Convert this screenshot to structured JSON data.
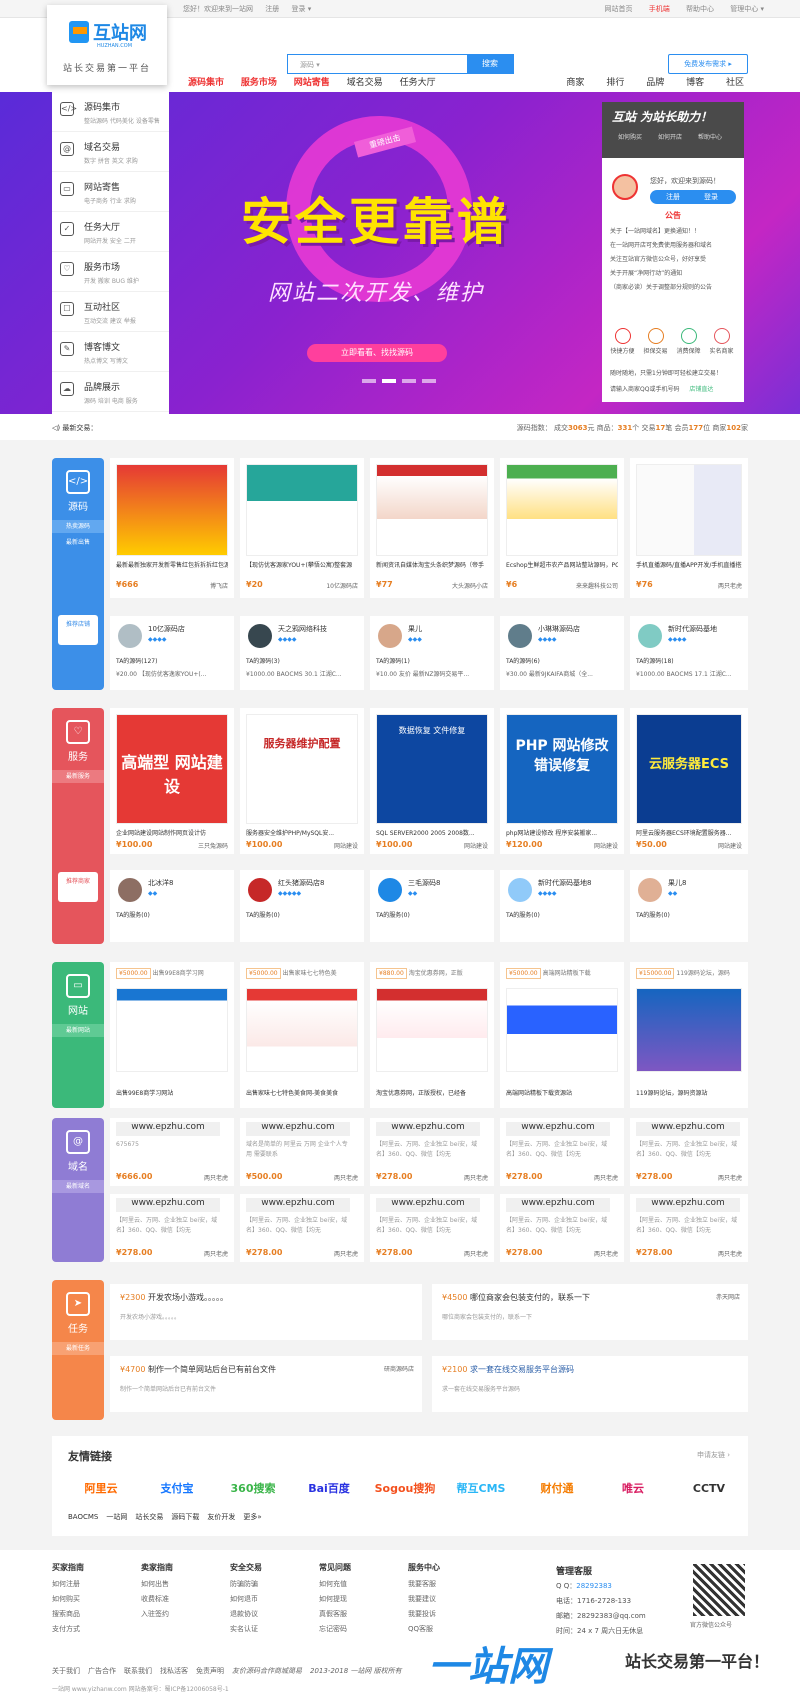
{
  "topbar": {
    "greeting": "您好！欢迎来到一站网",
    "login": "注册",
    "logout": "登录 ▾",
    "right": [
      "网站首页",
      "手机端",
      "帮助中心",
      "管理中心 ▾"
    ]
  },
  "logo": {
    "name": "互站网",
    "url": "HUZHAN.COM",
    "slogan": "站长交易第一平台"
  },
  "search": {
    "placeholder": "源码 ▾",
    "button": "搜索",
    "publish": "免费发布需求 ▸"
  },
  "nav": {
    "left": [
      "源码集市",
      "服务市场",
      "网站寄售",
      "域名交易",
      "任务大厅"
    ],
    "right": [
      "商家",
      "排行",
      "品牌",
      "博客",
      "社区"
    ]
  },
  "sidemenu": [
    {
      "icon": "</>",
      "title": "源码集市",
      "sub": "整站源码 代码美化 设备零售"
    },
    {
      "icon": "@",
      "title": "域名交易",
      "sub": "数字 拼音 英文 求购"
    },
    {
      "icon": "▭",
      "title": "网站寄售",
      "sub": "电子商务 行业 求购"
    },
    {
      "icon": "✓",
      "title": "任务大厅",
      "sub": "网站开发 安全 二开"
    },
    {
      "icon": "♡",
      "title": "服务市场",
      "sub": "开发 搬家 BUG 维护"
    },
    {
      "icon": "☐",
      "title": "互动社区",
      "sub": "互动交流 建议 举报"
    },
    {
      "icon": "✎",
      "title": "博客博文",
      "sub": "热点博文 写博文"
    },
    {
      "icon": "☁",
      "title": "品牌展示",
      "sub": "源码 培训 电商 服务"
    }
  ],
  "banner": {
    "ribbon": "重磅出击",
    "title": "安全更靠谱",
    "subtitle": "网站二次开发、维护",
    "button": "立即看看、找找源码"
  },
  "rpanel": {
    "brand": "互站 为站长助力！",
    "icons": [
      "如何购买",
      "如何开店",
      "帮助中心"
    ],
    "hello": "您好，欢迎来到源码！",
    "register": "注册",
    "login": "登录",
    "notice": "公告",
    "list": [
      "关于【一站网域名】更换通知！！",
      "在一站网开店可免费使用服务器和域名",
      "关注互站官方微信公众号，好好享受",
      "关于开展“净网行动”的通知",
      "（商家必读）关于调整部分规则的公告"
    ],
    "features": [
      "快捷方便",
      "担保交易",
      "消费保障",
      "实名商家"
    ],
    "promo": "随时随地，只需1分钟即可轻松建立交易！",
    "qq": "请输入商家QQ或手机号码",
    "qq_btn": "店铺直达"
  },
  "news": {
    "label": "最新交易：",
    "stats": [
      "源码指数：",
      "成交",
      "3063",
      "元",
      "商品：",
      "331",
      "个",
      "交易",
      "17",
      "笔",
      "会员",
      "177",
      "位",
      "商家",
      "102",
      "家"
    ]
  },
  "source": {
    "name": "源码",
    "tags": [
      "热卖源码",
      "最新出售"
    ],
    "rec": "推荐店铺",
    "items": [
      {
        "title": "最新最新独家开发新零售红包拆拆拆红包源",
        "price": "¥666",
        "shop": "博飞店"
      },
      {
        "title": "【现仿优客源家YOU+(攀悟公寓)整套源",
        "price": "¥20",
        "shop": "10亿源码店"
      },
      {
        "title": "新闻资讯自媒体淘宝头条织梦源码（帝手",
        "price": "¥77",
        "shop": "大头源码小店"
      },
      {
        "title": "Ecshop生鲜超市农产品网站整站源码，PC",
        "price": "¥6",
        "shop": "来来趣科技公司"
      },
      {
        "title": "手机直播源码/直播APP开发/手机直播搭建",
        "price": "¥76",
        "shop": "两只老虎"
      }
    ],
    "shops": [
      {
        "name": "10亿源码店",
        "count": "TA的源码(127)",
        "line": "¥20.00 【现仿优客逸家YOU+(..."
      },
      {
        "name": "天之鸦网络科技",
        "count": "TA的源码(3)",
        "line": "¥1000.00 BAOCMS 30.1 江湖C..."
      },
      {
        "name": "果儿",
        "count": "TA的源码(1)",
        "line": "¥10.00 友价 最新NZ源码交易平..."
      },
      {
        "name": "小琳琳源码店",
        "count": "TA的源码(6)",
        "line": "¥30.00 最新9JKAIFA商城（全..."
      },
      {
        "name": "新时代源码基地",
        "count": "TA的源码(18)",
        "line": "¥1000.00 BAOCMS 17.1 江湖C..."
      }
    ]
  },
  "service": {
    "name": "服务",
    "tags": [
      "最新服务"
    ],
    "rec": "推荐商家",
    "items": [
      {
        "img": "高端型 网站建设",
        "title": "企业网站建设网站制作网页设计仿",
        "price": "¥100.00",
        "shop": "三只兔源码"
      },
      {
        "img": "服务器维护配置",
        "title": "服务器安全维护PHP/MySQL安...",
        "price": "¥100.00",
        "shop": "网站建设"
      },
      {
        "img": "数据恢复 文件修复",
        "title": "SQL SERVER2000 2005 2008数...",
        "price": "¥100.00",
        "shop": "网站建设"
      },
      {
        "img": "PHP 网站修改 错误修复",
        "title": "php网站建设修改 程序安装搬家...",
        "price": "¥120.00",
        "shop": "网站建设"
      },
      {
        "img": "云服务器ECS",
        "title": "阿里云服务器ECS环境配置服务器...",
        "price": "¥50.00",
        "shop": "网站建设"
      }
    ],
    "shops": [
      {
        "name": "北冰洋8",
        "count": "TA的服务(0)"
      },
      {
        "name": "红头猪源码店8",
        "count": "TA的服务(0)"
      },
      {
        "name": "三毛源码8",
        "count": "TA的服务(0)"
      },
      {
        "name": "新时代源码基地8",
        "count": "TA的服务(0)"
      },
      {
        "name": "果儿8",
        "count": "TA的服务(0)"
      }
    ]
  },
  "site": {
    "name": "网站",
    "tags": [
      "最新网站"
    ],
    "items": [
      {
        "price": "¥5000.00",
        "tag": "出售99E8商学习网",
        "title": "出售99E8商学习网站"
      },
      {
        "price": "¥5000.00",
        "tag": "出售家味七七特色美",
        "title": "出售家味七七特色美食网-美食美食"
      },
      {
        "price": "¥880.00",
        "tag": "淘宝优惠券网，正版",
        "title": "淘宝优惠券网，正版授权，已经备"
      },
      {
        "price": "¥5000.00",
        "tag": "高端网站精板下载",
        "title": "高端网站精板下载资源站"
      },
      {
        "price": "¥15000.00",
        "tag": "119源码论坛，源码",
        "title": "119源码论坛，源码资源站"
      }
    ]
  },
  "domain": {
    "name": "域名",
    "tags": [
      "最新域名"
    ],
    "items": [
      {
        "domain": "www.epzhu.com",
        "desc": "675675",
        "price": "¥666.00",
        "shop": "两只老虎"
      },
      {
        "domain": "www.epzhu.com",
        "desc": "域名是简单的 阿里云 万网 企业个人专用 需要联系",
        "price": "¥500.00",
        "shop": "两只老虎"
      },
      {
        "domain": "www.epzhu.com",
        "desc": "【阿里云、万网、企业独立 bei安，域名】360、QQ、微信【均无",
        "price": "¥278.00",
        "shop": "两只老虎"
      },
      {
        "domain": "www.epzhu.com",
        "desc": "【阿里云、万网、企业独立 bei安，域名】360、QQ、微信【均无",
        "price": "¥278.00",
        "shop": "两只老虎"
      },
      {
        "domain": "www.epzhu.com",
        "desc": "【阿里云、万网、企业独立 bei安，域名】360、QQ、微信【均无",
        "price": "¥278.00",
        "shop": "两只老虎"
      },
      {
        "domain": "www.epzhu.com",
        "desc": "【阿里云、万网、企业独立 bei安，域名】360、QQ、微信【均无",
        "price": "¥278.00",
        "shop": "两只老虎"
      },
      {
        "domain": "www.epzhu.com",
        "desc": "【阿里云、万网、企业独立 bei安，域名】360、QQ、微信【均无",
        "price": "¥278.00",
        "shop": "两只老虎"
      },
      {
        "domain": "www.epzhu.com",
        "desc": "【阿里云、万网、企业独立 bei安，域名】360、QQ、微信【均无",
        "price": "¥278.00",
        "shop": "两只老虎"
      },
      {
        "domain": "www.epzhu.com",
        "desc": "【阿里云、万网、企业独立 bei安，域名】360、QQ、微信【均无",
        "price": "¥278.00",
        "shop": "两只老虎"
      },
      {
        "domain": "www.epzhu.com",
        "desc": "【阿里云、万网、企业独立 bei安，域名】360、QQ、微信【均无",
        "price": "¥278.00",
        "shop": "两只老虎"
      }
    ]
  },
  "task": {
    "name": "任务",
    "tags": [
      "最新任务"
    ],
    "items": [
      {
        "price": "¥2300",
        "title": "开发农场小游戏。。。。。",
        "desc": "开发农场小游戏。。。。。",
        "user": ""
      },
      {
        "price": "¥4500",
        "title": "哪位商家会包装支付的，联系一下",
        "desc": "哪位商家会包装支付的，联系一下",
        "user": "赤天网店"
      },
      {
        "price": "¥4700",
        "title": "制作一个简单网站后台已有前台文件",
        "desc": "制作一个简单网站后台已有前台文件",
        "user": "研商源码店"
      },
      {
        "price": "¥2100",
        "title": "求一套在线交易服务平台源码",
        "desc": "求一套在线交易服务平台源码",
        "user": ""
      }
    ]
  },
  "friends": {
    "title": "友情链接",
    "apply": "申请友链 ›",
    "logos": [
      "阿里云",
      "支付宝",
      "360搜索",
      "Bai百度",
      "Sogou搜狗",
      "帮互CMS",
      "财付通",
      "唯云",
      "CCTV"
    ],
    "text": [
      "BAOCMS",
      "一站网",
      "站长交易",
      "源码下载",
      "友价开发",
      "更多»"
    ]
  },
  "footer": {
    "cols": [
      {
        "title": "买家指南",
        "items": [
          "如何注册",
          "如何购买",
          "搜索商品",
          "支付方式"
        ]
      },
      {
        "title": "卖家指南",
        "items": [
          "如何出售",
          "收费标准",
          "入驻签约"
        ]
      },
      {
        "title": "安全交易",
        "items": [
          "防骗防骗",
          "如何退币",
          "退款协议",
          "实名认证"
        ]
      },
      {
        "title": "常见问题",
        "items": [
          "如何充值",
          "如何提现",
          "真假客服",
          "忘记密码"
        ]
      },
      {
        "title": "服务中心",
        "items": [
          "我要客服",
          "我要建议",
          "我要投诉",
          "QQ客服"
        ]
      }
    ],
    "contact": {
      "title": "管理客服",
      "qq_label": "Q Q：",
      "qq": "28292383",
      "phone": "电话：1716-2728-133",
      "email": "邮箱：28292383@qq.com",
      "time": "时间：24 x 7 周六日无休息"
    },
    "qr_cap": "官方微信公众号",
    "links": [
      "关于我们",
      "广告合作",
      "联系我们",
      "找私活客",
      "免责声明",
      "友价源码合作商城简易",
      "2013-2018 一站网 版权所有"
    ],
    "copy": "一站网 www.yizhanw.com 网站备案号：蜀ICP备12006058号-1",
    "ad_big": "一站网",
    "ad_slogan": "站长交易第一平台！"
  },
  "colors": {
    "blue": "#3c8fe8",
    "red": "#e5555c",
    "green": "#3bb97a",
    "purple": "#8f7cd4",
    "orange": "#f5864a",
    "accent": "#e67e22"
  }
}
